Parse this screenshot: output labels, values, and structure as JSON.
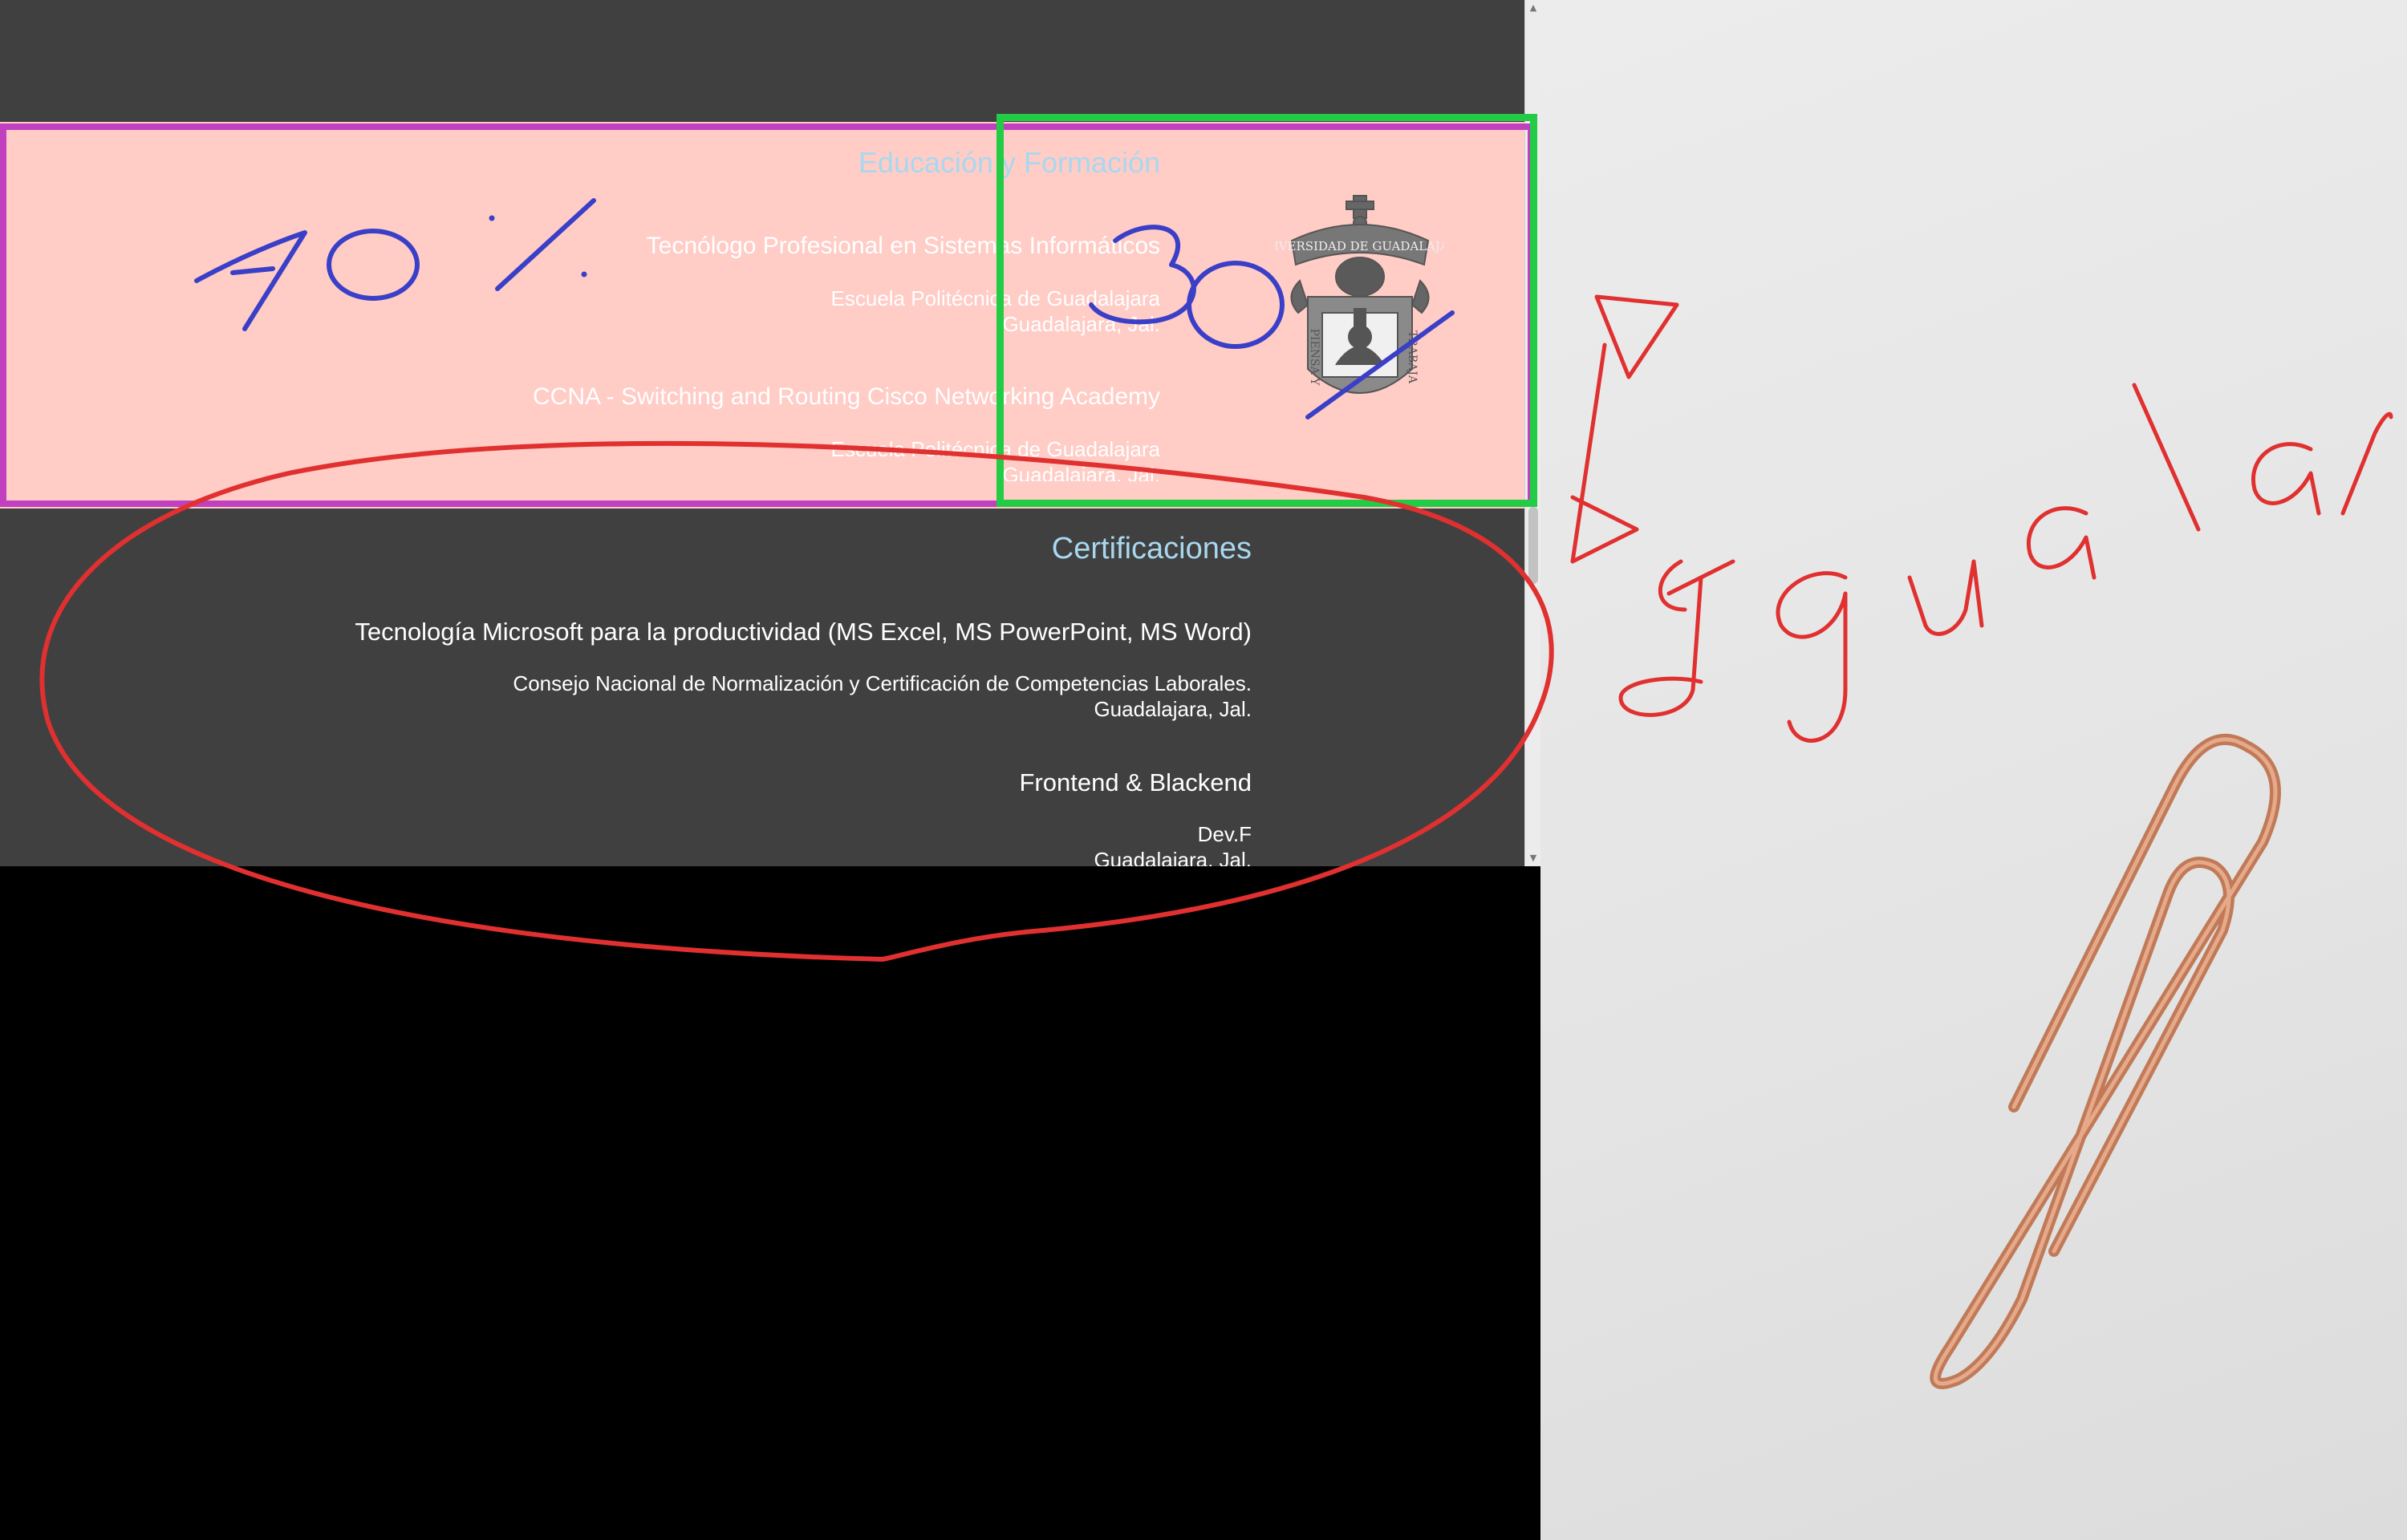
{
  "education": {
    "title": "Educación y Formación",
    "entries": [
      {
        "title": "Tecnólogo Profesional en Sistemas Informáticos",
        "school": "Escuela Politécnica de Guadalajara",
        "location": "Guadalajara, Jal."
      },
      {
        "title": "CCNA - Switching and Routing Cisco Networking Academy",
        "school": "Escuela Politécnica de Guadalajara",
        "location": "Guadalajara, Jal."
      }
    ],
    "seal": {
      "top_text": "UNIVERSIDAD DE GUADALAJARA",
      "left_text": "PIENSA Y",
      "right_text": "TRABAJA"
    }
  },
  "certifications": {
    "title": "Certificaciones",
    "entries": [
      {
        "title": "Tecnología Microsoft para la productividad (MS Excel, MS PowerPoint, MS Word)",
        "org": "Consejo Nacional de Normalización y Certificación de Competencias Laborales.",
        "location": "Guadalajara, Jal."
      },
      {
        "title": "Frontend & Blackend",
        "org": "Dev.F",
        "location": "Guadalajara, Jal."
      }
    ]
  },
  "annotations": {
    "left_percent": "70 %",
    "right_percent": "30 %",
    "note": "Igualar",
    "colors": {
      "magenta_box": "#c040c0",
      "green_box": "#22cc44",
      "blue_ink": "#3a3fc8",
      "red_ink": "#e03030"
    }
  },
  "icons": {
    "scroll_up": "triangle-up-icon",
    "scroll_down": "triangle-down-icon",
    "paperclip": "paperclip-icon"
  }
}
